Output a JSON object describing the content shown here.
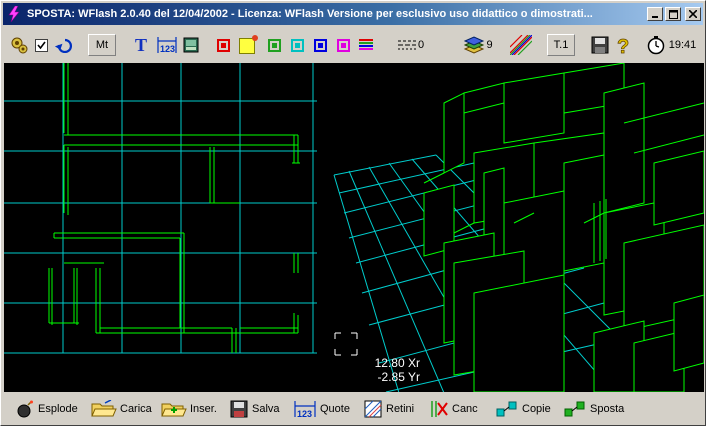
{
  "window": {
    "title": "SPOSTA: WFlash 2.0.40 del 12/04/2002 - Licenza: WFlash Versione per esclusivo uso didattico o dimostrati...",
    "minimize_label": "_",
    "maximize_label": "□",
    "close_label": "✕"
  },
  "toolbar": {
    "units_label": "Mt",
    "text_label": "T",
    "dims_label": "123",
    "line_style_count": "0",
    "layers_count": "9",
    "thickness_label": "T.1",
    "clock_time": "19:41"
  },
  "colors": {
    "palette": [
      "#e00000",
      "#ffff40",
      "#20a020",
      "#00c0c0",
      "#0000e0",
      "#e000e0"
    ],
    "grid_plan": "#00cccc",
    "walls": "#00ff00",
    "canvas_bg": "#000000"
  },
  "canvas": {
    "readout_x": "12.80 Xr",
    "readout_y": "-2.85 Yr"
  },
  "bottombar": {
    "items": [
      {
        "label": "Esplode",
        "icon": "bomb-icon"
      },
      {
        "label": "Carica",
        "icon": "folder-open-icon"
      },
      {
        "label": "Inser.",
        "icon": "folder-insert-icon"
      },
      {
        "label": "Salva",
        "icon": "floppy-icon"
      },
      {
        "label": "Quote",
        "icon": "dimension-icon"
      },
      {
        "label": "Retini",
        "icon": "hatch-icon"
      },
      {
        "label": "Canc",
        "icon": "erase-icon"
      },
      {
        "label": "Copie",
        "icon": "copy-icon"
      },
      {
        "label": "Sposta",
        "icon": "move-icon"
      }
    ]
  }
}
